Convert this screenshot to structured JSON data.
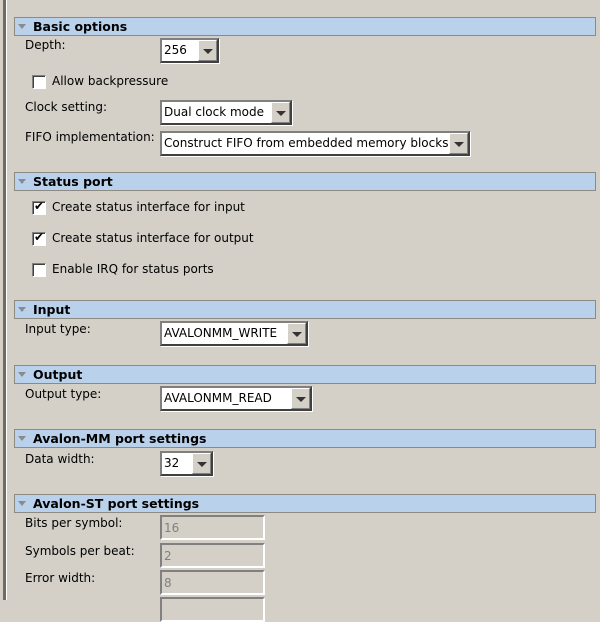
{
  "basic_options": {
    "title": "Basic options",
    "depth_label": "Depth:",
    "depth_value": "256",
    "allow_backpressure_label": "Allow backpressure",
    "allow_backpressure": false,
    "clock_label": "Clock setting:",
    "clock_value": "Dual clock mode",
    "fifo_label": "FIFO implementation:",
    "fifo_value": "Construct FIFO from embedded memory blocks"
  },
  "status_port": {
    "title": "Status port",
    "items": [
      {
        "label": "Create status interface for input",
        "checked": true
      },
      {
        "label": "Create status interface for output",
        "checked": true
      },
      {
        "label": "Enable IRQ for status ports",
        "checked": false
      }
    ]
  },
  "input": {
    "title": "Input",
    "type_label": "Input type:",
    "type_value": "AVALONMM_WRITE"
  },
  "output": {
    "title": "Output",
    "type_label": "Output type:",
    "type_value": "AVALONMM_READ"
  },
  "avalon_mm": {
    "title": "Avalon-MM port settings",
    "data_width_label": "Data width:",
    "data_width_value": "32"
  },
  "avalon_st": {
    "title": "Avalon-ST port settings",
    "fields": [
      {
        "label": "Bits per symbol:",
        "value": "16"
      },
      {
        "label": "Symbols per beat:",
        "value": "2"
      },
      {
        "label": "Error width:",
        "value": "8"
      }
    ]
  },
  "colors": {
    "header": "#b9d1ea",
    "background": "#d4d0c8"
  }
}
